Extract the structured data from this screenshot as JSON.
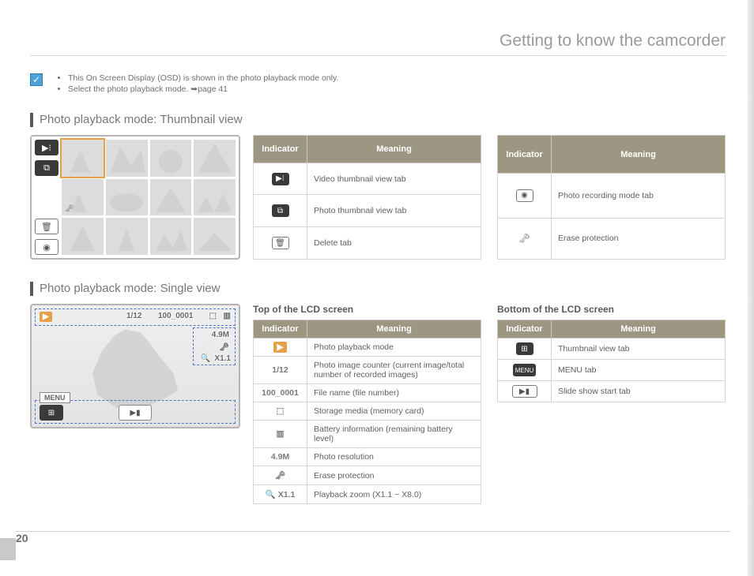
{
  "header": {
    "title": "Getting to know the camcorder"
  },
  "notes": {
    "items": [
      "This On Screen Display (OSD) is shown in the photo playback mode only.",
      "Select the photo playback mode. ➥page 41"
    ]
  },
  "section_thumb": {
    "title": "Photo playback mode: Thumbnail view",
    "table1": {
      "headers": [
        "Indicator",
        "Meaning"
      ],
      "rows": [
        {
          "icon": "video-thumb-tab",
          "meaning": "Video thumbnail view tab"
        },
        {
          "icon": "photo-thumb-tab",
          "meaning": "Photo thumbnail view tab"
        },
        {
          "icon": "delete-tab",
          "meaning": "Delete tab"
        }
      ]
    },
    "table2": {
      "headers": [
        "Indicator",
        "Meaning"
      ],
      "rows": [
        {
          "icon": "photo-rec-tab",
          "meaning": "Photo recording mode tab"
        },
        {
          "icon": "erase-protection",
          "meaning": "Erase protection"
        }
      ]
    }
  },
  "section_single": {
    "title": "Photo playback mode: Single view",
    "lcd": {
      "play_icon": "▶",
      "counter": "1/12",
      "filename": "100_0001",
      "storage_icon": "⬚",
      "battery_icon": "▥",
      "resolution": "4.9M",
      "protect_icon": "🗝",
      "zoom_icon": "🔍",
      "zoom_text": "X1.1",
      "thumb_tab_icon": "⊞",
      "menu_label": "MENU",
      "slideshow_icon": "▶▮"
    },
    "col_top": {
      "heading": "Top of the LCD screen",
      "headers": [
        "Indicator",
        "Meaning"
      ],
      "rows": [
        {
          "label": "▶",
          "meaning": "Photo playback mode"
        },
        {
          "label": "1/12",
          "meaning": "Photo image counter (current image/total number of recorded images)"
        },
        {
          "label": "100_0001",
          "meaning": "File name (file number)"
        },
        {
          "label": "⬚",
          "meaning": "Storage media (memory card)"
        },
        {
          "label": "▥",
          "meaning": "Battery information (remaining battery level)"
        },
        {
          "label": "4.9M",
          "meaning": "Photo resolution"
        },
        {
          "label": "🗝",
          "meaning": "Erase protection"
        },
        {
          "label": "🔍 X1.1",
          "meaning": "Playback zoom (X1.1 ~ X8.0)"
        }
      ]
    },
    "col_bottom": {
      "heading": "Bottom of the LCD screen",
      "headers": [
        "Indicator",
        "Meaning"
      ],
      "rows": [
        {
          "label": "⊞",
          "meaning": "Thumbnail view tab"
        },
        {
          "label": "MENU",
          "meaning": "MENU tab"
        },
        {
          "label": "▶▮",
          "meaning": "Slide show start tab"
        }
      ]
    }
  },
  "page_number": "20"
}
